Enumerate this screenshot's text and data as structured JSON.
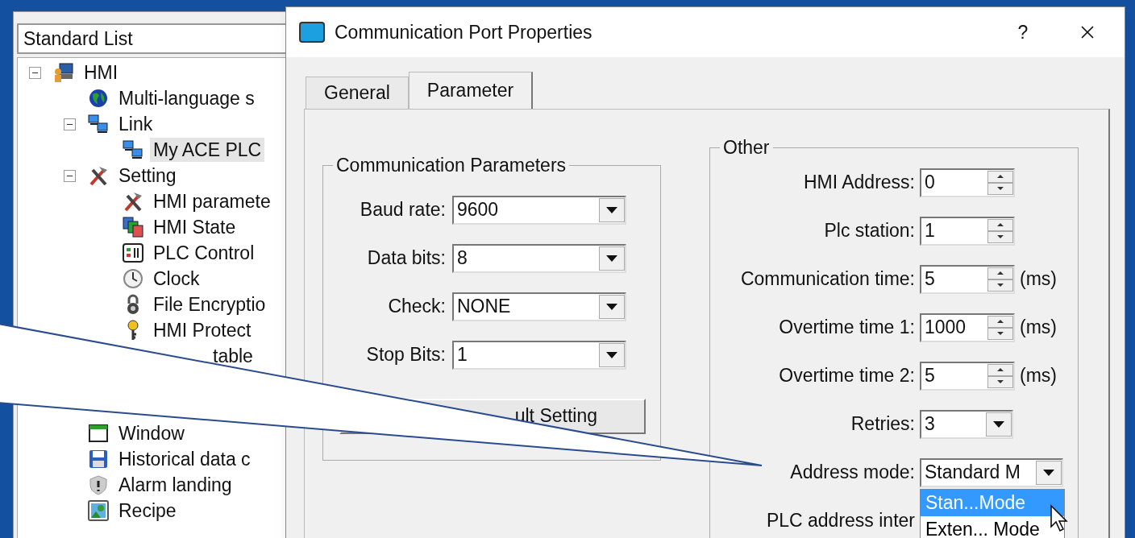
{
  "left_panel": {
    "view_selector": "Standard List",
    "tree": [
      {
        "label": "HMI",
        "kind": "hmi",
        "expanded": true,
        "selected": false,
        "children": [
          {
            "label": "Multi-language s",
            "kind": "globe",
            "selected": false
          },
          {
            "label": "Link",
            "kind": "link",
            "expanded": true,
            "selected": false,
            "children": [
              {
                "label": "My ACE PLC",
                "kind": "link",
                "selected": true
              }
            ]
          },
          {
            "label": "Setting",
            "kind": "tools",
            "expanded": true,
            "selected": false,
            "children": [
              {
                "label": "HMI paramete",
                "kind": "tools",
                "selected": false
              },
              {
                "label": "HMI State",
                "kind": "state",
                "selected": false
              },
              {
                "label": "PLC Control",
                "kind": "control",
                "selected": false
              },
              {
                "label": "Clock",
                "kind": "clock",
                "selected": false
              },
              {
                "label": "File Encryptio",
                "kind": "lock",
                "selected": false
              },
              {
                "label": "HMI Protect",
                "kind": "key",
                "selected": false
              },
              {
                "label": "table",
                "kind": "covered",
                "selected": false
              }
            ]
          },
          {
            "label": "Window",
            "kind": "window",
            "selected": false,
            "after_covered": true
          },
          {
            "label": "Historical data c",
            "kind": "disk",
            "selected": false
          },
          {
            "label": "Alarm landing",
            "kind": "shield",
            "selected": false
          },
          {
            "label": "Recipe",
            "kind": "picture",
            "selected": false
          }
        ]
      }
    ]
  },
  "dialog": {
    "title": "Communication Port Properties",
    "help": "?",
    "tabs": [
      {
        "label": "General",
        "selected": false
      },
      {
        "label": "Parameter",
        "selected": true
      }
    ],
    "comm_group": {
      "title": "Communication Parameters",
      "fields": [
        {
          "label": "Baud rate:",
          "value": "9600"
        },
        {
          "label": "Data bits:",
          "value": "8"
        },
        {
          "label": "Check:",
          "value": "NONE"
        },
        {
          "label": "Stop Bits:",
          "value": "1"
        }
      ],
      "button": "ult Setting"
    },
    "other_group": {
      "title": "Other",
      "fields": [
        {
          "kind": "spinner",
          "label": "HMI Address:",
          "value": "0"
        },
        {
          "kind": "spinner",
          "label": "Plc station:",
          "value": "1"
        },
        {
          "kind": "spinner",
          "label": "Communication time:",
          "value": "5",
          "unit": "(ms)"
        },
        {
          "kind": "spinner",
          "label": "Overtime time 1:",
          "value": "1000",
          "unit": "(ms)"
        },
        {
          "kind": "spinner",
          "label": "Overtime time 2:",
          "value": "5",
          "unit": "(ms)"
        },
        {
          "kind": "dropdown",
          "label": "Retries:",
          "value": "3",
          "wide": false
        },
        {
          "kind": "dropdown",
          "label": "Address mode:",
          "value": "Standard M",
          "wide": true,
          "open": true,
          "options": [
            {
              "label": "Stan...Mode",
              "selected": true
            },
            {
              "label": "Exten... Mode",
              "selected": false
            }
          ]
        },
        {
          "kind": "label",
          "label": "PLC address inter"
        }
      ]
    }
  }
}
